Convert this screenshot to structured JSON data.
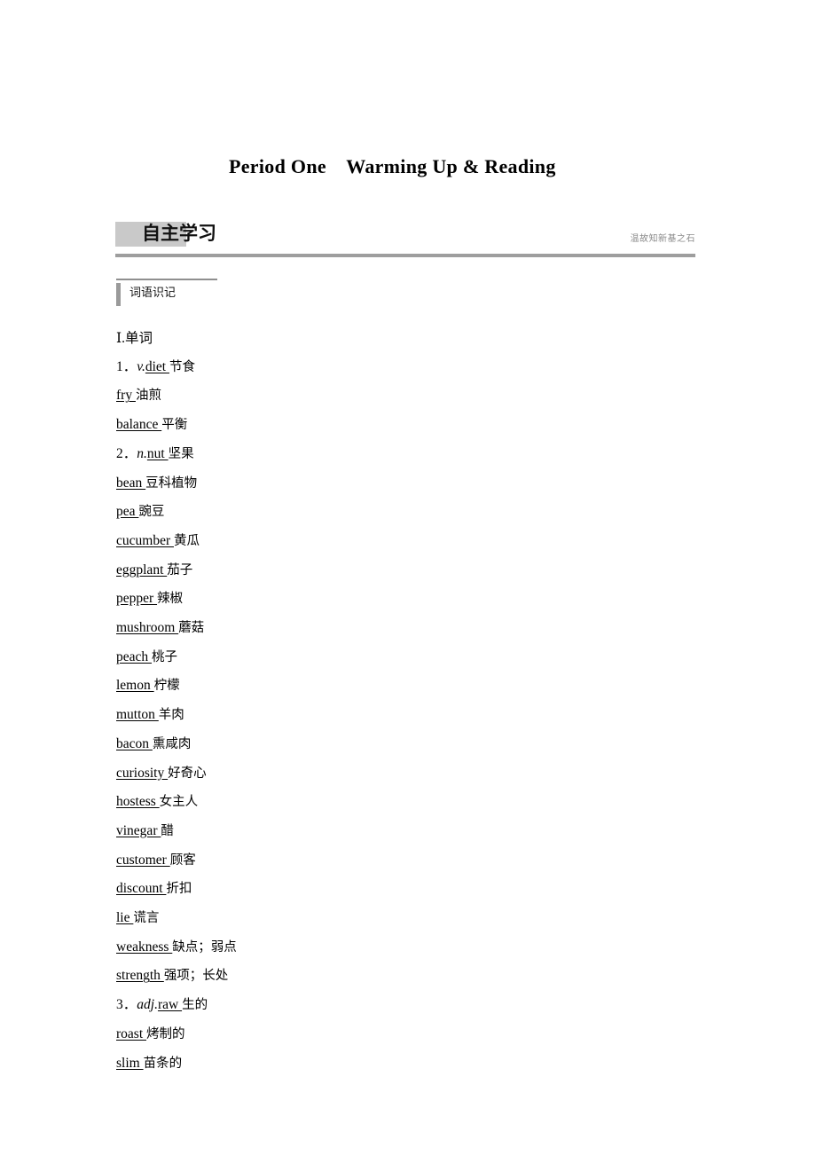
{
  "page": {
    "title": "Period One　Warming Up & Reading"
  },
  "banner": {
    "title": "自主学习",
    "motto": "温故知新基之石"
  },
  "subsection": {
    "label": "词语识记"
  },
  "wordlist": {
    "group_label": "Ⅰ.单词",
    "entries": [
      {
        "num": "1．",
        "pos": "v.",
        "en": "diet",
        "cn": "节食"
      },
      {
        "num": "",
        "pos": "",
        "en": "fry",
        "cn": "油煎"
      },
      {
        "num": "",
        "pos": "",
        "en": "balance",
        "cn": "平衡"
      },
      {
        "num": "2．",
        "pos": "n.",
        "en": "nut",
        "cn": "坚果"
      },
      {
        "num": "",
        "pos": "",
        "en": "bean",
        "cn": "豆科植物"
      },
      {
        "num": "",
        "pos": "",
        "en": "pea",
        "cn": "豌豆"
      },
      {
        "num": "",
        "pos": "",
        "en": "cucumber",
        "cn": "黄瓜"
      },
      {
        "num": "",
        "pos": "",
        "en": "eggplant",
        "cn": "茄子"
      },
      {
        "num": "",
        "pos": "",
        "en": "pepper",
        "cn": "辣椒"
      },
      {
        "num": "",
        "pos": "",
        "en": "mushroom",
        "cn": "蘑菇"
      },
      {
        "num": "",
        "pos": "",
        "en": "peach",
        "cn": "桃子"
      },
      {
        "num": "",
        "pos": "",
        "en": "lemon",
        "cn": "柠檬"
      },
      {
        "num": "",
        "pos": "",
        "en": "mutton",
        "cn": "羊肉"
      },
      {
        "num": "",
        "pos": "",
        "en": "bacon",
        "cn": "熏咸肉"
      },
      {
        "num": "",
        "pos": "",
        "en": "curiosity",
        "cn": "好奇心"
      },
      {
        "num": "",
        "pos": "",
        "en": "hostess",
        "cn": "女主人"
      },
      {
        "num": "",
        "pos": "",
        "en": "vinegar",
        "cn": "醋"
      },
      {
        "num": "",
        "pos": "",
        "en": "customer",
        "cn": "顾客"
      },
      {
        "num": "",
        "pos": "",
        "en": "discount",
        "cn": "折扣"
      },
      {
        "num": "",
        "pos": "",
        "en": "lie",
        "cn": "谎言"
      },
      {
        "num": "",
        "pos": "",
        "en": "weakness",
        "cn": "缺点；弱点"
      },
      {
        "num": "",
        "pos": "",
        "en": "strength",
        "cn": "强项；长处"
      },
      {
        "num": "3．",
        "pos": "adj.",
        "en": "raw",
        "cn": "生的"
      },
      {
        "num": "",
        "pos": "",
        "en": "roast",
        "cn": "烤制的"
      },
      {
        "num": "",
        "pos": "",
        "en": "slim",
        "cn": "苗条的"
      }
    ]
  }
}
